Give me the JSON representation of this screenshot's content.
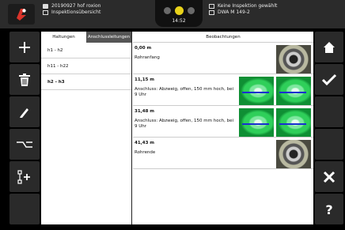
{
  "header": {
    "project_name": "20190927 hof roxion",
    "view_name": "Inspektionsübersicht",
    "clock": "14:52",
    "inspection_status": "Keine Inspektion gewählt",
    "standard": "DWA M 149-2"
  },
  "tabs": [
    {
      "label": "Haltungen"
    },
    {
      "label": "Anschlussleitungen"
    }
  ],
  "haltungen": [
    {
      "label": "h1 - h2"
    },
    {
      "label": "h11 - h22"
    },
    {
      "label": "h2 - h3",
      "selected": true
    }
  ],
  "observations_title": "Beobachtungen",
  "observations": [
    {
      "distance": "0,00 m",
      "description": "Rohranfang"
    },
    {
      "distance": "11,15 m",
      "description": "Anschluss: Abzweig, offen,  150 mm hoch, bei 9 Uhr"
    },
    {
      "distance": "31,48 m",
      "description": "Anschluss: Abzweig, offen,  150 mm hoch, bei 9 Uhr"
    },
    {
      "distance": "41,43 m",
      "description": "Rohrende"
    }
  ],
  "colors": {
    "accent_red": "#d9342b",
    "status_yellow": "#e8d21a",
    "status_gray": "#6a6a6a",
    "cctv_blue": "#1a2fd0"
  },
  "left_toolbar_icons": [
    "plus-icon",
    "trash-icon",
    "pencil-icon",
    "connection-icon",
    "add-branch-icon",
    "empty"
  ],
  "right_toolbar_icons": [
    "home-icon",
    "check-icon",
    "empty",
    "empty",
    "close-icon",
    "help-icon"
  ]
}
